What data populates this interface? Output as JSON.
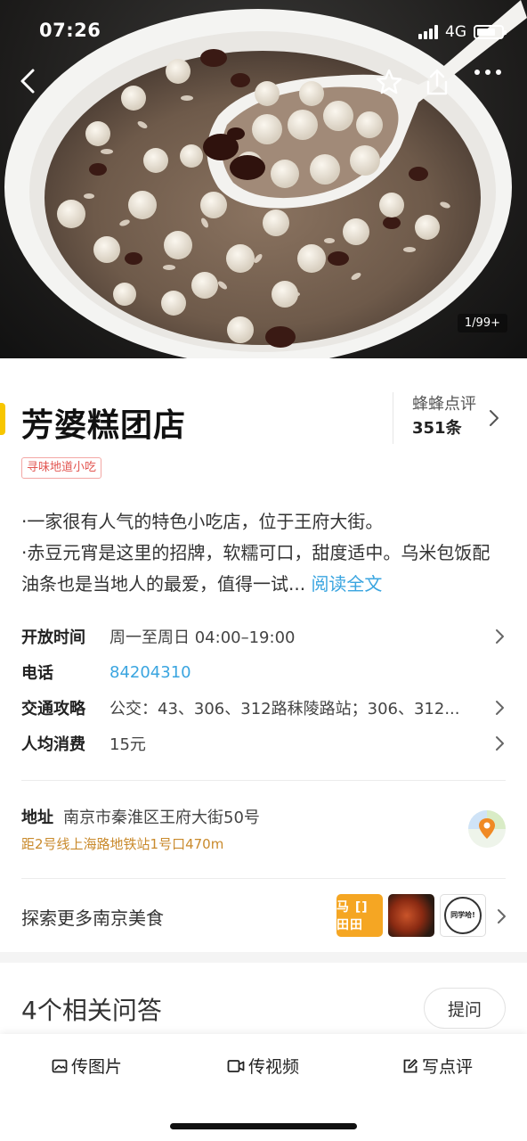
{
  "status_bar": {
    "time": "07:26",
    "network": "4G"
  },
  "hero": {
    "photo_counter": "1/99+",
    "buttons": {
      "back": "chevron-left-icon",
      "favorite": "star-outline-icon",
      "share": "share-icon",
      "more": "more-dots-icon"
    }
  },
  "shop": {
    "name": "芳婆糕团店",
    "tag": "寻味地道小吃",
    "reviews": {
      "source": "蜂蜂点评",
      "count": "351条"
    },
    "description": {
      "line1": "·一家很有人气的特色小吃店，位于王府大街。",
      "line2": "·赤豆元宵是这里的招牌，软糯可口，甜度适中。乌米包饭配油条也是当地人的最爱，值得一试...",
      "read_more": "阅读全文"
    }
  },
  "info": [
    {
      "label": "开放时间",
      "value": "周一至周日 04:00–19:00"
    },
    {
      "label": "电话",
      "value": "84204310"
    },
    {
      "label": "交通攻略",
      "value": "公交：43、306、312路秣陵路站；306、312..."
    },
    {
      "label": "人均消费",
      "value": "15元"
    }
  ],
  "address": {
    "label": "地址",
    "value": "南京市秦淮区王府大街50号",
    "distance": "距2号线上海路地铁站1号口470m"
  },
  "explore": {
    "label": "探索更多南京美食",
    "thumb1_text": "马 [] 田田",
    "thumb3_text": "同学哈!"
  },
  "qa": {
    "title": "4个相关问答",
    "ask_label": "提问"
  },
  "toolbar": {
    "upload_photo": "传图片",
    "upload_video": "传视频",
    "write_review": "写点评"
  },
  "colors": {
    "accent_yellow": "#f7c600",
    "link_blue": "#3aa5e0",
    "tag_red": "#e25550",
    "distance_orange": "#c98a2c"
  }
}
